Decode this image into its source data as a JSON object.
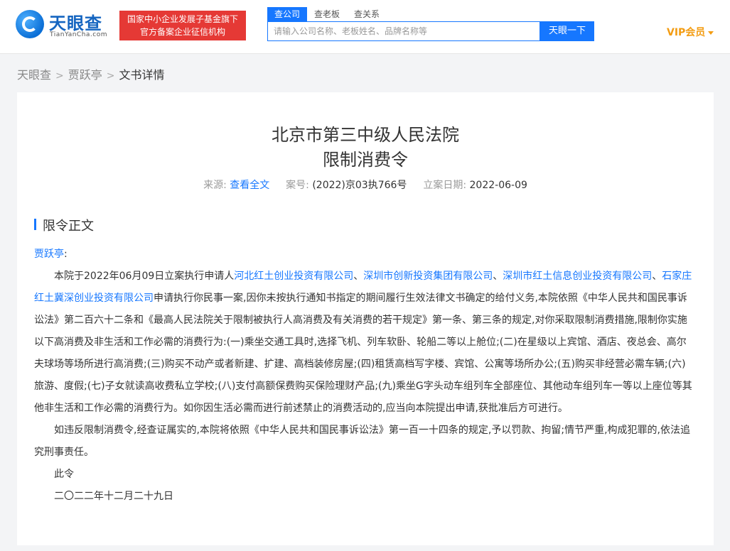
{
  "header": {
    "logo_name": "天眼查",
    "logo_domain": "TianYanCha.com",
    "slogan_line1": "国家中小企业发展子基金旗下",
    "slogan_line2": "官方备案企业征信机构",
    "tabs": [
      "查公司",
      "查老板",
      "查关系"
    ],
    "search_placeholder": "请输入公司名称、老板姓名、品牌名称等",
    "search_button": "天眼一下",
    "vip_label": "VIP会员"
  },
  "breadcrumb": [
    "天眼查",
    "贾跃亭",
    "文书详情"
  ],
  "document": {
    "court": "北京市第三中级人民法院",
    "title": "限制消费令",
    "source_label": "来源:",
    "source_link": "查看全文",
    "case_label": "案号:",
    "case_no": "(2022)京03执766号",
    "date_label": "立案日期:",
    "date": "2022-06-09",
    "section_title": "限令正文",
    "addressee": "贾跃亭",
    "addressee_suffix": ":",
    "p1_intro": "本院于2022年06月09日立案执行申请人",
    "applicant1": "河北红土创业投资有限公司",
    "sep1": "、",
    "applicant2": "深圳市创新投资集团有限公司",
    "sep2": "、",
    "applicant3": "深圳市红土信息创业投资有限公司",
    "sep3": "、",
    "applicant4": "石家庄红土冀深创业投资有限公司",
    "p1_rest": "申请执行你民事一案,因你未按执行通知书指定的期间履行生效法律文书确定的给付义务,本院依照《中华人民共和国民事诉讼法》第二百六十二条和《最高人民法院关于限制被执行人高消费及有关消费的若干规定》第一条、第三条的规定,对你采取限制消费措施,限制你实施以下高消费及非生活和工作必需的消费行为:(一)乘坐交通工具时,选择飞机、列车软卧、轮船二等以上舱位;(二)在星级以上宾馆、酒店、夜总会、高尔夫球场等场所进行高消费;(三)购买不动产或者新建、扩建、高档装修房屋;(四)租赁高档写字楼、宾馆、公寓等场所办公;(五)购买非经营必需车辆;(六)旅游、度假;(七)子女就读高收费私立学校;(八)支付高额保费购买保险理财产品;(九)乘坐G字头动车组列车全部座位、其他动车组列车一等以上座位等其他非生活和工作必需的消费行为。如你因生活必需而进行前述禁止的消费活动的,应当向本院提出申请,获批准后方可进行。",
    "p2": "如违反限制消费令,经查证属实的,本院将依照《中华人民共和国民事诉讼法》第一百一十四条的规定,予以罚款、拘留;情节严重,构成犯罪的,依法追究刑事责任。",
    "closing": "此令",
    "sign_date": "二〇二二年十二月二十九日"
  },
  "colors": {
    "accent": "#1677ff",
    "slogan_bg": "#e53935",
    "vip": "#f39c12"
  }
}
